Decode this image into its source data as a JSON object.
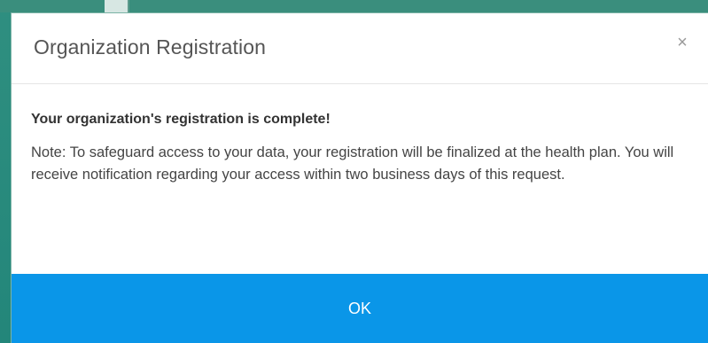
{
  "dialog": {
    "title": "Organization Registration",
    "close_icon": "close-icon",
    "close_glyph": "×",
    "message_title": "Your organization's registration is complete!",
    "message_note": "Note: To safeguard access to your data, your registration will be finalized at the health plan. You will receive notification regarding your access within two business days of this request.",
    "ok_label": "OK"
  },
  "colors": {
    "backdrop": "#23867a",
    "footer": "#0a96e8",
    "title_text": "#555555",
    "body_text": "#444444"
  }
}
